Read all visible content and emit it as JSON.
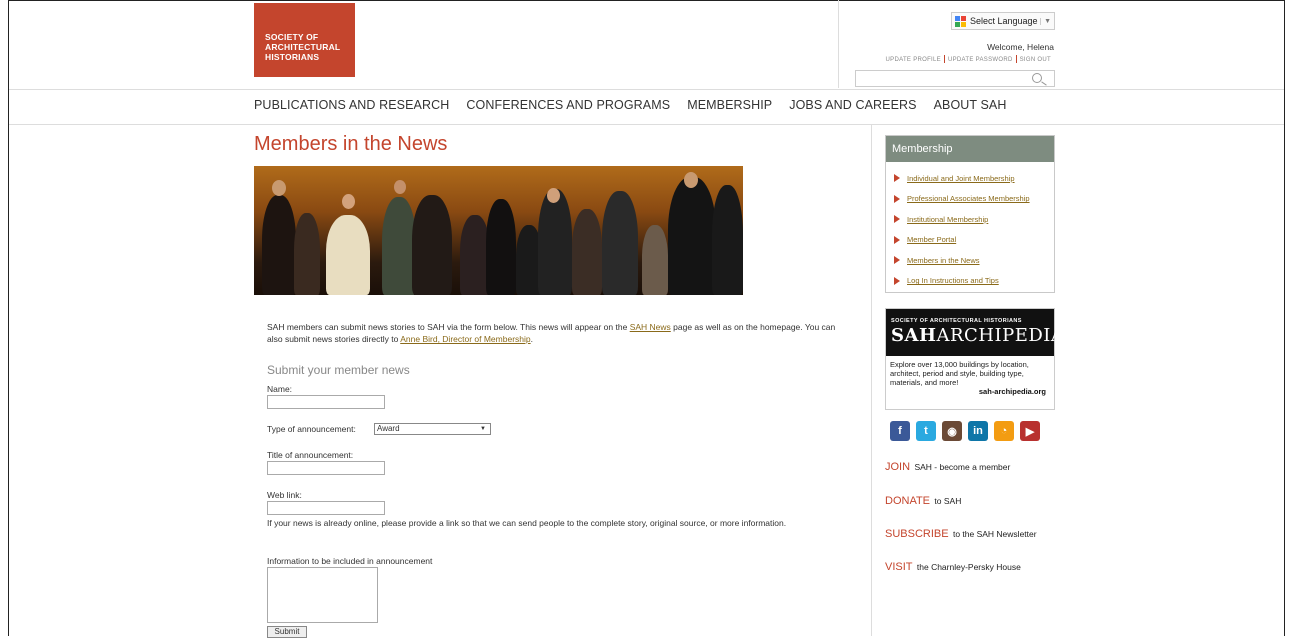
{
  "logo": {
    "line1": "SOCIETY OF",
    "line2": "ARCHITECTURAL",
    "line3": "HISTORIANS"
  },
  "header": {
    "language_label": "Select Language",
    "welcome": "Welcome, Helena",
    "update_profile": "UPDATE PROFILE",
    "update_password": "UPDATE PASSWORD",
    "sign_out": "SIGN OUT",
    "search_placeholder": ""
  },
  "nav": {
    "items": [
      "PUBLICATIONS AND RESEARCH",
      "CONFERENCES AND PROGRAMS",
      "MEMBERSHIP",
      "JOBS AND CAREERS",
      "ABOUT SAH"
    ]
  },
  "main": {
    "title": "Members in the News",
    "intro_1": "SAH members can submit news stories to SAH via the form below. This news will appear on the",
    "intro_link1": "SAH News",
    "intro_2": "page as well as on the homepage. You can also submit news stories directly to",
    "intro_link2": "Anne Bird, Director of Membership",
    "intro_3": ".",
    "form": {
      "title": "Submit your member news",
      "name_label": "Name:",
      "type_label": "Type of announcement:",
      "type_value": "Award",
      "title_label": "Title of announcement:",
      "weblink_label": "Web link:",
      "weblink_help": "If your news is already online, please provide a link so that we can send people to the complete story, original source, or more information.",
      "info_label": "Information to be included in announcement",
      "submit_label": "Submit"
    }
  },
  "sidebar": {
    "membership_title": "Membership",
    "links": [
      "Individual and Joint Membership",
      "Professional Associates Membership",
      "Institutional Membership",
      "Member Portal",
      "Members in the News",
      "Log In Instructions and Tips"
    ],
    "archipedia": {
      "org": "SOCIETY OF ARCHITECTURAL HISTORIANS",
      "brand_bold": "SAH",
      "brand_light": "ARCHIPEDIA",
      "desc": "Explore over 13,000 buildings by location, architect, period and style, building type, materials, and more!",
      "url": "sah-archipedia.org"
    },
    "social": [
      {
        "icon": "facebook-icon",
        "glyph": "f",
        "color": "#3b5998"
      },
      {
        "icon": "twitter-icon",
        "glyph": "t",
        "color": "#2aa9e0"
      },
      {
        "icon": "instagram-icon",
        "glyph": "◉",
        "color": "#6b4a36"
      },
      {
        "icon": "linkedin-icon",
        "glyph": "in",
        "color": "#0e76a8"
      },
      {
        "icon": "rss-icon",
        "glyph": "◔",
        "color": "#f39c12"
      },
      {
        "icon": "youtube-icon",
        "glyph": "▶",
        "color": "#b8312f"
      }
    ],
    "cta": [
      {
        "key": "JOIN",
        "text": "SAH - become a member"
      },
      {
        "key": "DONATE",
        "text": "to SAH"
      },
      {
        "key": "SUBSCRIBE",
        "text": "to the SAH Newsletter"
      },
      {
        "key": "VISIT",
        "text": "the Charnley-Persky House"
      }
    ]
  },
  "colors": {
    "accent": "#c4452d",
    "sidebar_head": "#7e8c80",
    "link": "#8a6a1a"
  }
}
